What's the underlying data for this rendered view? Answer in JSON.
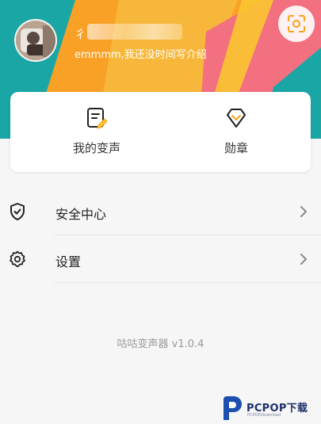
{
  "colors": {
    "header_orange": "#f9a126",
    "header_teal": "#1ba6a6",
    "header_pink": "#f2707f",
    "header_yellow": "#fbc531",
    "accent": "#f7a21b",
    "watermark_blue": "#1c4fb0"
  },
  "profile": {
    "username_visible_char": "彳",
    "bio": "emmmm,我还没时间写介绍"
  },
  "header": {
    "scan_icon": "scan-icon"
  },
  "card": {
    "items": [
      {
        "label": "我的变声",
        "icon": "voice-record-icon"
      },
      {
        "label": "勋章",
        "icon": "medal-icon"
      }
    ]
  },
  "menu": [
    {
      "label": "安全中心",
      "icon": "shield-check-icon"
    },
    {
      "label": "设置",
      "icon": "gear-icon"
    }
  ],
  "footer": {
    "version": "咕咕变声器 v1.0.4"
  },
  "watermark": {
    "text": "PCPOP下载",
    "subtext": "PCPOP.Download"
  }
}
